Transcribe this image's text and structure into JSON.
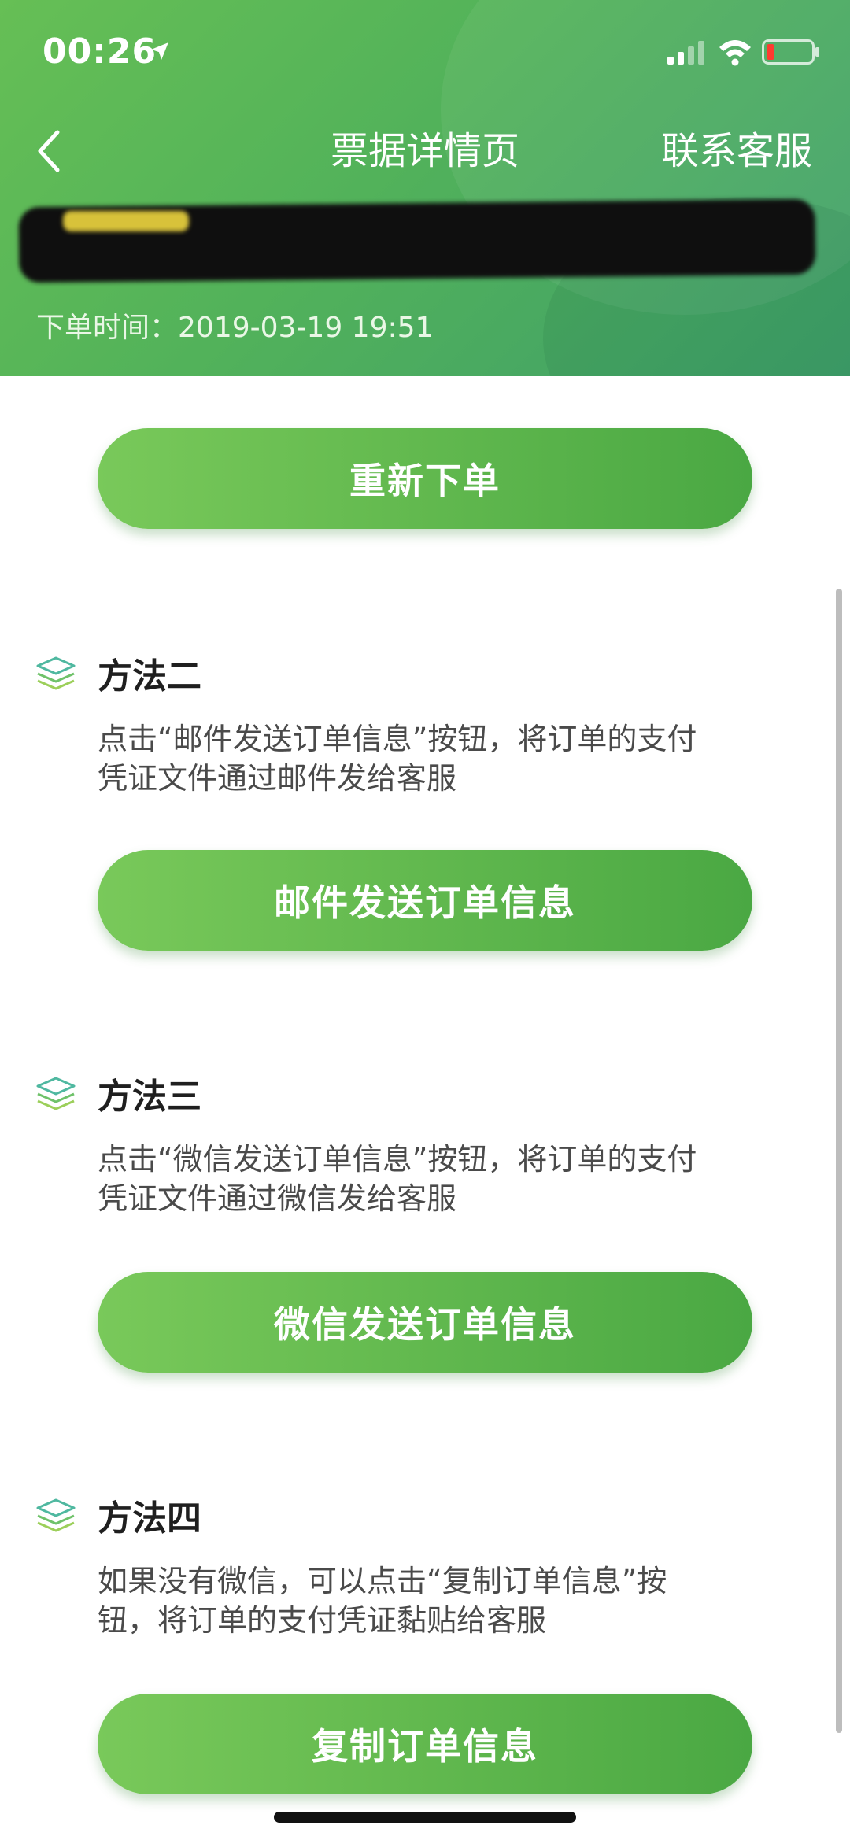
{
  "status_bar": {
    "time": "00:26"
  },
  "nav": {
    "title": "票据详情页",
    "contact": "联系客服"
  },
  "order": {
    "time_label": "下单时间：",
    "time_value": "2019-03-19 19:51"
  },
  "buttons": {
    "reorder": "重新下单",
    "email_send": "邮件发送订单信息",
    "wechat_send": "微信发送订单信息",
    "copy_info": "复制订单信息"
  },
  "methods": [
    {
      "title": "方法二",
      "desc": "点击“邮件发送订单信息”按钮，将订单的支付\n凭证文件通过邮件发给客服"
    },
    {
      "title": "方法三",
      "desc": "点击“微信发送订单信息”按钮，将订单的支付\n凭证文件通过微信发给客服"
    },
    {
      "title": "方法四",
      "desc": "如果没有微信，可以点击“复制订单信息”按\n钮，将订单的支付凭证黏贴给客服"
    }
  ],
  "colors": {
    "header_green": "#52b25a",
    "button_green_start": "#79c95a",
    "button_green_end": "#4aa843",
    "icon_green": "#5cbf6a"
  },
  "icons": {
    "back": "chevron-left-icon",
    "location": "location-arrow-icon",
    "signal": "cellular-signal-icon",
    "wifi": "wifi-icon",
    "battery": "battery-icon",
    "method": "layers-icon"
  }
}
